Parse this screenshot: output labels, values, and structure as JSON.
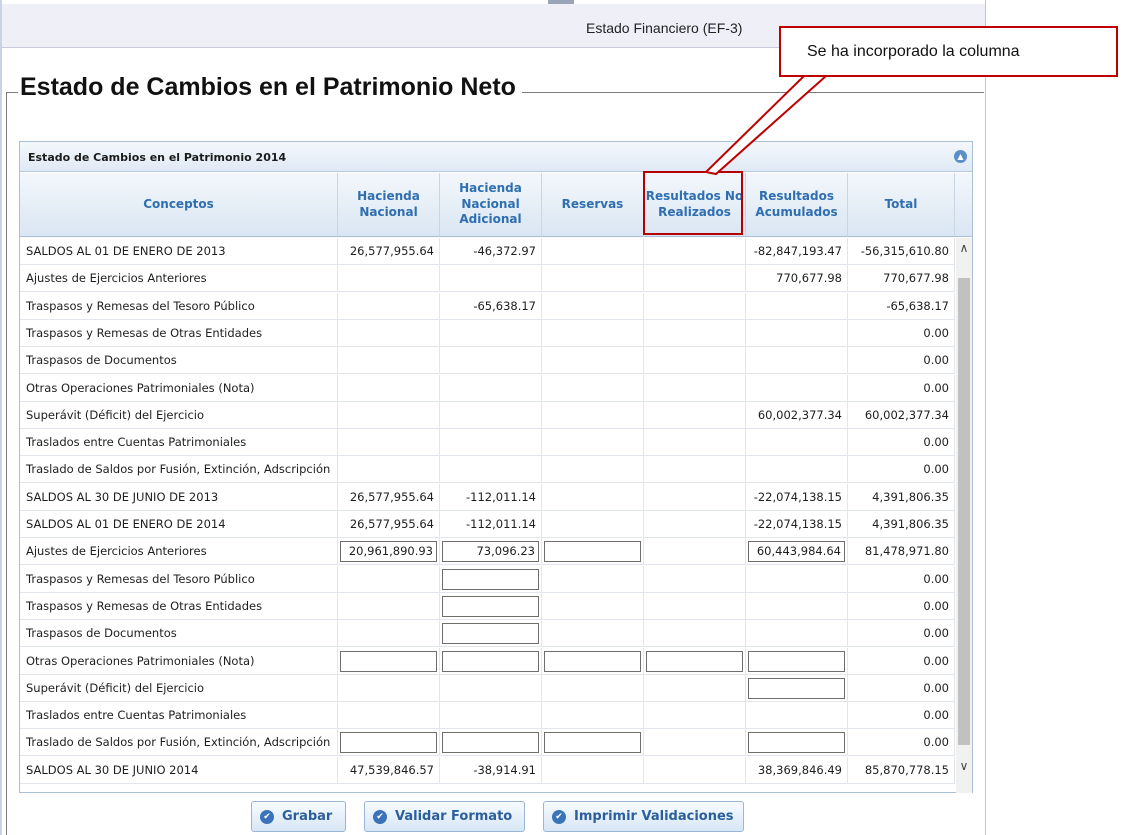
{
  "window": {
    "title": "Estado Financiero (EF-3)"
  },
  "page_title": "Estado de Cambios en el Patrimonio Neto",
  "callout": "Se ha incorporado la columna",
  "panel": {
    "title": "Estado de Cambios en el Patrimonio 2014",
    "columns": [
      "Conceptos",
      "Hacienda Nacional",
      "Hacienda Nacional Adicional",
      "Reservas",
      "Resultados No Realizados",
      "Resultados Acumulados",
      "Total"
    ],
    "rows": [
      {
        "label": "SALDOS AL 01 DE ENERO DE 2013",
        "values": [
          "26,577,955.64",
          "-46,372.97",
          "",
          "",
          "-82,847,193.47",
          "-56,315,610.80"
        ],
        "inputs": [
          false,
          false,
          false,
          false,
          false
        ]
      },
      {
        "label": "Ajustes de Ejercicios Anteriores",
        "values": [
          "",
          "",
          "",
          "",
          "770,677.98",
          "770,677.98"
        ],
        "inputs": [
          false,
          false,
          false,
          false,
          false
        ]
      },
      {
        "label": "Traspasos y Remesas del Tesoro Público",
        "values": [
          "",
          "-65,638.17",
          "",
          "",
          "",
          "-65,638.17"
        ],
        "inputs": [
          false,
          false,
          false,
          false,
          false
        ]
      },
      {
        "label": "Traspasos y Remesas  de Otras Entidades",
        "values": [
          "",
          "",
          "",
          "",
          "",
          "0.00"
        ],
        "inputs": [
          false,
          false,
          false,
          false,
          false
        ]
      },
      {
        "label": "Traspasos de Documentos",
        "values": [
          "",
          "",
          "",
          "",
          "",
          "0.00"
        ],
        "inputs": [
          false,
          false,
          false,
          false,
          false
        ]
      },
      {
        "label": "Otras Operaciones Patrimoniales (Nota)",
        "values": [
          "",
          "",
          "",
          "",
          "",
          "0.00"
        ],
        "inputs": [
          false,
          false,
          false,
          false,
          false
        ]
      },
      {
        "label": "Superávit (Déficit) del Ejercicio",
        "values": [
          "",
          "",
          "",
          "",
          "60,002,377.34",
          "60,002,377.34"
        ],
        "inputs": [
          false,
          false,
          false,
          false,
          false
        ]
      },
      {
        "label": "Traslados entre Cuentas Patrimoniales",
        "values": [
          "",
          "",
          "",
          "",
          "",
          "0.00"
        ],
        "inputs": [
          false,
          false,
          false,
          false,
          false
        ]
      },
      {
        "label": "Traslado de Saldos por Fusión, Extinción, Adscripción",
        "values": [
          "",
          "",
          "",
          "",
          "",
          "0.00"
        ],
        "inputs": [
          false,
          false,
          false,
          false,
          false
        ]
      },
      {
        "label": "SALDOS AL 30 DE JUNIO DE 2013",
        "values": [
          "26,577,955.64",
          "-112,011.14",
          "",
          "",
          "-22,074,138.15",
          "4,391,806.35"
        ],
        "inputs": [
          false,
          false,
          false,
          false,
          false
        ]
      },
      {
        "label": "SALDOS AL 01 DE ENERO DE 2014",
        "values": [
          "26,577,955.64",
          "-112,011.14",
          "",
          "",
          "-22,074,138.15",
          "4,391,806.35"
        ],
        "inputs": [
          false,
          false,
          false,
          false,
          false
        ]
      },
      {
        "label": "Ajustes de Ejercicios Anteriores",
        "values": [
          "20,961,890.93",
          "73,096.23",
          "",
          "",
          "60,443,984.64",
          "81,478,971.80"
        ],
        "inputs": [
          true,
          true,
          true,
          false,
          true
        ]
      },
      {
        "label": "Traspasos y Remesas del Tesoro Público",
        "values": [
          "",
          "",
          "",
          "",
          "",
          "0.00"
        ],
        "inputs": [
          false,
          true,
          false,
          false,
          false
        ]
      },
      {
        "label": "Traspasos y Remesas  de Otras Entidades",
        "values": [
          "",
          "",
          "",
          "",
          "",
          "0.00"
        ],
        "inputs": [
          false,
          true,
          false,
          false,
          false
        ]
      },
      {
        "label": "Traspasos de Documentos",
        "values": [
          "",
          "",
          "",
          "",
          "",
          "0.00"
        ],
        "inputs": [
          false,
          true,
          false,
          false,
          false
        ]
      },
      {
        "label": "Otras Operaciones Patrimoniales (Nota)",
        "values": [
          "",
          "",
          "",
          "",
          "",
          "0.00"
        ],
        "inputs": [
          true,
          true,
          true,
          true,
          true
        ]
      },
      {
        "label": "Superávit (Déficit) del Ejercicio",
        "values": [
          "",
          "",
          "",
          "",
          "",
          "0.00"
        ],
        "inputs": [
          false,
          false,
          false,
          false,
          true
        ]
      },
      {
        "label": "Traslados entre Cuentas Patrimoniales",
        "values": [
          "",
          "",
          "",
          "",
          "",
          "0.00"
        ],
        "inputs": [
          false,
          false,
          false,
          false,
          false
        ]
      },
      {
        "label": "Traslado de Saldos por Fusión, Extinción, Adscripción",
        "values": [
          "",
          "",
          "",
          "",
          "",
          "0.00"
        ],
        "inputs": [
          true,
          true,
          true,
          false,
          true
        ]
      },
      {
        "label": "SALDOS AL 30 DE JUNIO 2014",
        "values": [
          "47,539,846.57",
          "-38,914.91",
          "",
          "",
          "38,369,846.49",
          "85,870,778.15"
        ],
        "inputs": [
          false,
          false,
          false,
          false,
          false
        ]
      }
    ]
  },
  "buttons": {
    "grabar": "Grabar",
    "validar": "Validar Formato",
    "imprimir": "Imprimir Validaciones"
  },
  "colors": {
    "header_text": "#2f6fb1",
    "callout_border": "#c00000",
    "button_text": "#2b5f9c"
  }
}
